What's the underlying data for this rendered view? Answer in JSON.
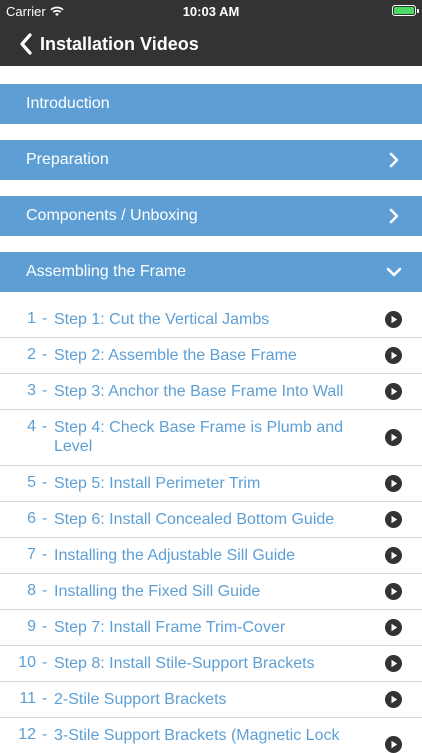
{
  "status_bar": {
    "carrier": "Carrier",
    "time": "10:03 AM"
  },
  "nav": {
    "title": "Installation Videos"
  },
  "sections": [
    {
      "label": "Introduction"
    },
    {
      "label": "Preparation"
    },
    {
      "label": "Components / Unboxing"
    },
    {
      "label": "Assembling the Frame"
    }
  ],
  "videos": [
    {
      "num": "1",
      "title": "Step 1: Cut the Vertical Jambs"
    },
    {
      "num": "2",
      "title": "Step 2: Assemble the Base Frame"
    },
    {
      "num": "3",
      "title": "Step 3: Anchor the Base Frame Into Wall"
    },
    {
      "num": "4",
      "title": "Step 4: Check Base Frame is Plumb and Level"
    },
    {
      "num": "5",
      "title": "Step 5: Install Perimeter Trim"
    },
    {
      "num": "6",
      "title": "Step 6: Install Concealed Bottom Guide"
    },
    {
      "num": "7",
      "title": "Installing the Adjustable Sill Guide"
    },
    {
      "num": "8",
      "title": "Installing the Fixed Sill Guide"
    },
    {
      "num": "9",
      "title": "Step 7: Install Frame Trim-Cover"
    },
    {
      "num": "10",
      "title": "Step 8: Install Stile-Support Brackets"
    },
    {
      "num": "11",
      "title": "2-Stile Support Brackets"
    },
    {
      "num": "12",
      "title": "3-Stile Support Brackets (Magnetic Lock"
    }
  ],
  "colors": {
    "header_bg": "#333333",
    "section_bg": "#5d9fd5",
    "link": "#5d9fd5",
    "battery": "#4cd964"
  }
}
